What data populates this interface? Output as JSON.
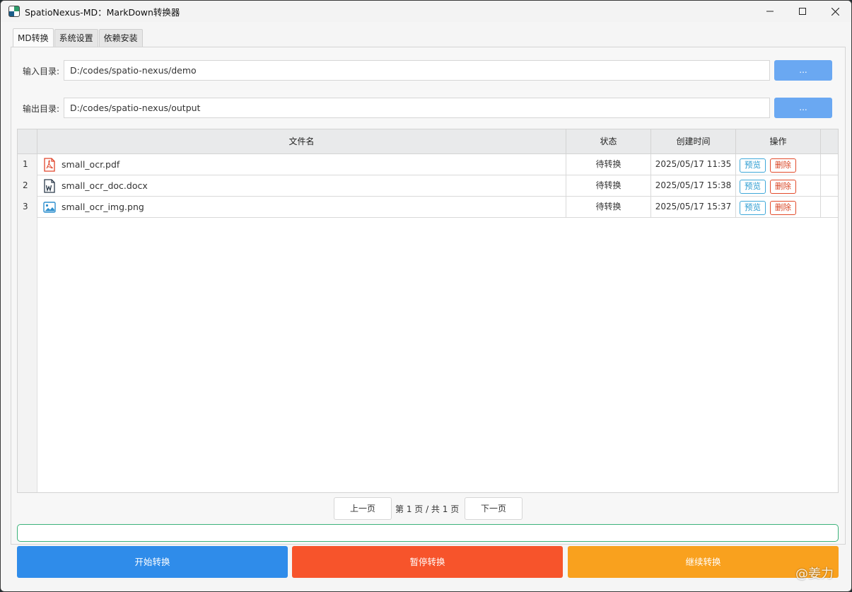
{
  "window": {
    "title": "SpatioNexus-MD：MarkDown转换器",
    "controls": [
      "minimize",
      "maximize",
      "close"
    ]
  },
  "tabs": [
    {
      "label": "MD转换",
      "active": true
    },
    {
      "label": "系统设置",
      "active": false
    },
    {
      "label": "依赖安装",
      "active": false
    }
  ],
  "input_dir": {
    "label": "输入目录:",
    "value": "D:/codes/spatio-nexus/demo",
    "browse_label": "..."
  },
  "output_dir": {
    "label": "输出目录:",
    "value": "D:/codes/spatio-nexus/output",
    "browse_label": "..."
  },
  "table": {
    "headers": {
      "filename": "文件名",
      "status": "状态",
      "created": "创建时间",
      "ops": "操作"
    },
    "rows": [
      {
        "index": "1",
        "filename": "small_ocr.pdf",
        "icon": "pdf-file-icon",
        "status": "待转换",
        "created": "2025/05/17 11:35",
        "preview": "预览",
        "delete": "删除"
      },
      {
        "index": "2",
        "filename": "small_ocr_doc.docx",
        "icon": "word-file-icon",
        "status": "待转换",
        "created": "2025/05/17 15:38",
        "preview": "预览",
        "delete": "删除"
      },
      {
        "index": "3",
        "filename": "small_ocr_img.png",
        "icon": "image-file-icon",
        "status": "待转换",
        "created": "2025/05/17 15:37",
        "preview": "预览",
        "delete": "删除"
      }
    ]
  },
  "pager": {
    "prev": "上一页",
    "info": "第 1 页 / 共 1 页",
    "next": "下一页"
  },
  "progress": {
    "value": 0
  },
  "actions": {
    "start": "开始转换",
    "pause": "暂停转换",
    "resume": "继续转换"
  },
  "watermark": "@姜力",
  "colors": {
    "browse": "#6aa8f2",
    "start": "#2f8cea",
    "pause": "#f7542b",
    "resume": "#f9a11e",
    "progress_border": "#3bb27a",
    "preview": "#2a9bd0",
    "delete": "#d94423"
  }
}
